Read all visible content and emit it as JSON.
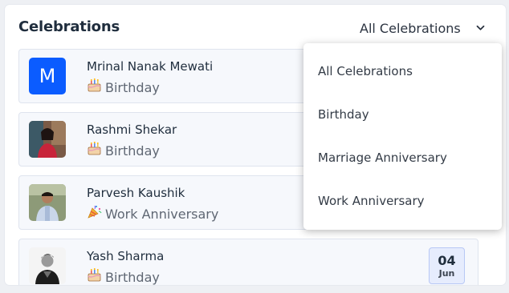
{
  "header": {
    "title": "Celebrations",
    "filter_selected": "All Celebrations",
    "filter_icon": "chevron-down-icon"
  },
  "celebrations": [
    {
      "name": "Mrinal Nanak Mewati",
      "avatar_letter": "M",
      "type": "Birthday",
      "type_icon": "birthday-cake-icon"
    },
    {
      "name": "Rashmi Shekar",
      "avatar": "photo",
      "type": "Birthday",
      "type_icon": "birthday-cake-icon"
    },
    {
      "name": "Parvesh Kaushik",
      "avatar": "photo",
      "type": "Work Anniversary",
      "type_icon": "party-popper-icon"
    },
    {
      "name": "Yash Sharma",
      "avatar": "photo",
      "type": "Birthday",
      "type_icon": "birthday-cake-icon",
      "date_day": "04",
      "date_month": "Jun"
    }
  ],
  "dropdown": {
    "options": [
      "All Celebrations",
      "Birthday",
      "Marriage Anniversary",
      "Work Anniversary"
    ]
  },
  "colors": {
    "accent": "#0b5cff",
    "card_bg": "#f6f8fc",
    "date_bg": "#e6ecfd"
  }
}
